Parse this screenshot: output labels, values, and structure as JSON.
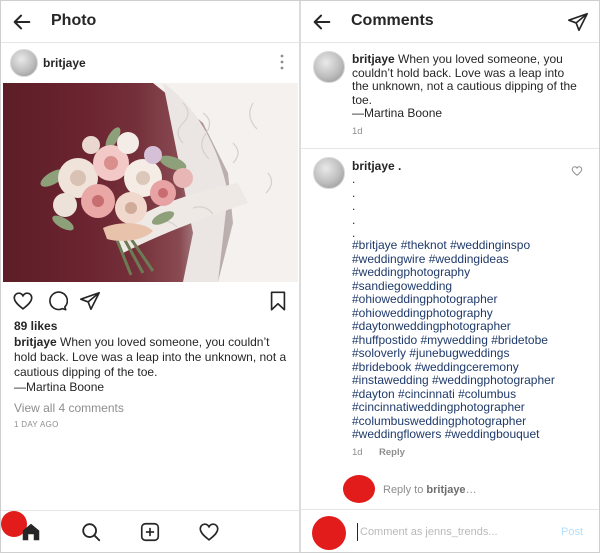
{
  "left_panel": {
    "header": {
      "title": "Photo",
      "back_icon": "arrow-left-icon"
    },
    "post": {
      "username": "britjaye",
      "more_icon": "vertical-ellipsis-icon",
      "photo_alt": "bride holding bouquet",
      "likes": "89 likes",
      "caption_user": "britjaye",
      "caption_text": " When you loved someone, you couldn’t hold back. Love was a leap into the unknown, not a cautious dipping of the toe.",
      "caption_author": "—Martina Boone",
      "view_comments": "View all 4 comments",
      "time_ago": "1 DAY AGO",
      "action_icons": [
        "heart-icon",
        "comment-bubble-icon",
        "paper-plane-icon",
        "bookmark-icon"
      ]
    },
    "bottom_nav": [
      "home-icon",
      "search-icon",
      "add-post-icon",
      "heart-icon",
      "profile-avatar"
    ]
  },
  "right_panel": {
    "header": {
      "title": "Comments",
      "back_icon": "arrow-left-icon",
      "send_icon": "paper-plane-icon"
    },
    "caption_comment": {
      "username": "britjaye",
      "text": " When you loved someone, you couldn’t hold back. Love was a leap into the unknown, not a cautious dipping of the toe.",
      "author": "—Martina Boone",
      "time": "1d"
    },
    "hashtag_comment": {
      "username": "britjaye .",
      "dots": [
        ".",
        ".",
        ".",
        ".",
        "."
      ],
      "hashtags": [
        "#britjaye #theknot #weddinginspo",
        "#weddingwire #weddingideas",
        "#weddingphotography",
        "#sandiegowedding",
        "#ohioweddingphotographer",
        "#ohioweddingphotography",
        "#daytonweddingphotographer",
        "#huffpostido #mywedding #bridetobe",
        "#soloverly #junebugweddings",
        "#bridebook #weddingceremony",
        "#instawedding #weddingphotographer",
        "#dayton #cincinnati #columbus",
        "#cincinnatiweddingphotographer",
        "#columbusweddingphotographer",
        "#weddingflowers #weddingbouquet"
      ],
      "time": "1d",
      "reply_label": "Reply"
    },
    "reply_to": {
      "prefix": "Reply to ",
      "username": "britjaye",
      "suffix": "…"
    },
    "composer": {
      "placeholder": "Comment as jenns_trends...",
      "post_label": "Post"
    }
  },
  "colors": {
    "accent_red": "#e21b1b",
    "hashtag_blue": "#1f3a6b",
    "muted_gray": "#8e8e8e",
    "post_button": "#b2dffc"
  }
}
